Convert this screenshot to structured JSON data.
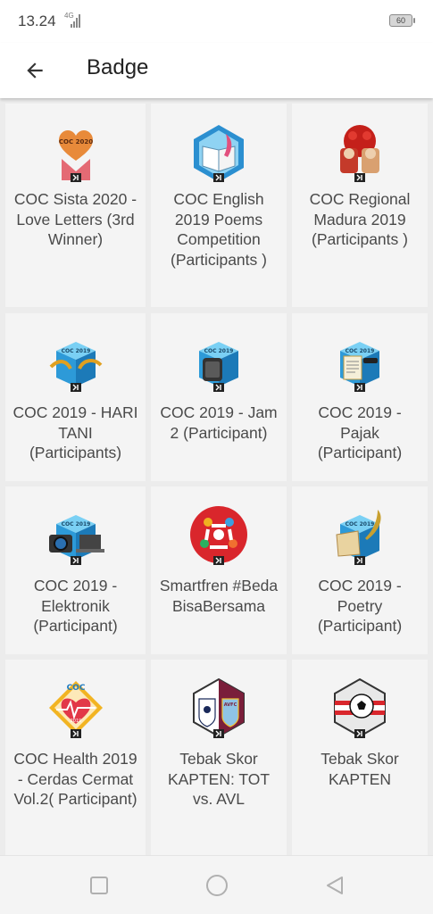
{
  "status_bar": {
    "time": "13.24",
    "network": "4G",
    "battery": "60"
  },
  "header": {
    "title": "Badge"
  },
  "badges": [
    {
      "label": "COC Sista 2020 - Love Letters (3rd Winner)",
      "icon": "heart-envelope-badge-icon",
      "icon_text": "COC 2020"
    },
    {
      "label": "COC English 2019 Poems Competition (Participants )",
      "icon": "book-hexagon-badge-icon"
    },
    {
      "label": "COC Regional Madura 2019 (Participants )",
      "icon": "red-bull-mascot-badge-icon"
    },
    {
      "label": "COC 2019 - HARI TANI (Participants)",
      "icon": "wheat-cube-badge-icon",
      "icon_text": "COC 2019"
    },
    {
      "label": "COC 2019 - Jam 2 (Participant)",
      "icon": "clock-cube-badge-icon",
      "icon_text": "COC 2019"
    },
    {
      "label": "COC 2019 - Pajak (Participant)",
      "icon": "document-cube-badge-icon",
      "icon_text": "COC 2019"
    },
    {
      "label": "COC 2019 - Elektronik (Participant)",
      "icon": "camera-laptop-cube-badge-icon",
      "icon_text": "COC 2019"
    },
    {
      "label": "Smartfren #BedaBisaBersama",
      "icon": "people-circle-badge-icon"
    },
    {
      "label": "COC 2019 - Poetry (Participant)",
      "icon": "scroll-quill-cube-badge-icon",
      "icon_text": "COC 2019"
    },
    {
      "label": "COC Health 2019 - Cerdas Cermat Vol.2( Participant)",
      "icon": "heart-health-badge-icon",
      "icon_text": "COC",
      "icon_year": "2019"
    },
    {
      "label": "Tebak Skor KAPTEN: TOT vs. AVL",
      "icon": "football-crests-badge-icon",
      "icon_text": "AVFC"
    },
    {
      "label": "Tebak Skor KAPTEN",
      "icon": "football-ball-badge-icon"
    }
  ],
  "colors": {
    "card": "#f4f4f4",
    "grid_bg": "#ececec",
    "label": "#4a4a4a",
    "kaskus_logo": "#1a1a1a"
  },
  "nav": {
    "recent": "square-icon",
    "home": "circle-icon",
    "back": "triangle-icon"
  }
}
